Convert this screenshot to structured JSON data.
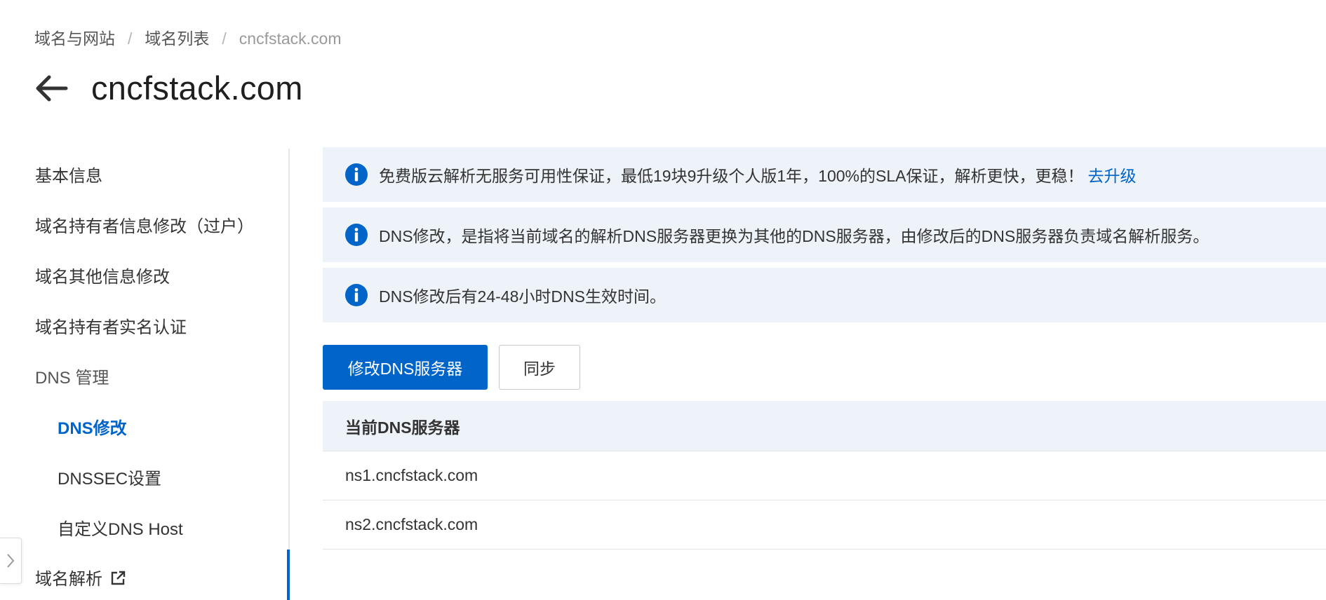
{
  "breadcrumb": {
    "items": [
      "域名与网站",
      "域名列表",
      "cncfstack.com"
    ],
    "separator": "/"
  },
  "header": {
    "title": "cncfstack.com"
  },
  "sidebar": {
    "items": [
      "基本信息",
      "域名持有者信息修改（过户）",
      "域名其他信息修改",
      "域名持有者实名认证",
      "DNS 管理",
      "DNS修改",
      "DNSSEC设置",
      "自定义DNS Host",
      "域名解析"
    ],
    "active_item": "DNS修改"
  },
  "notices": [
    {
      "text": "免费版云解析无服务可用性保证，最低19块9升级个人版1年，100%的SLA保证，解析更快，更稳！",
      "link": "去升级"
    },
    {
      "text": "DNS修改，是指将当前域名的解析DNS服务器更换为其他的DNS服务器，由修改后的DNS服务器负责域名解析服务。"
    },
    {
      "text": "DNS修改后有24-48小时DNS生效时间。"
    }
  ],
  "actions": {
    "modify_dns": "修改DNS服务器",
    "sync": "同步"
  },
  "dns_table": {
    "header": "当前DNS服务器",
    "rows": [
      "ns1.cncfstack.com",
      "ns2.cncfstack.com"
    ]
  },
  "colors": {
    "accent": "#0064c8",
    "notice_bg": "#eef2f9",
    "info_icon": "#0064c8"
  },
  "icons": {
    "back": "arrow-left-icon",
    "info": "info-circle-icon",
    "external_link": "external-link-icon",
    "collapse": "chevron-right-icon"
  }
}
